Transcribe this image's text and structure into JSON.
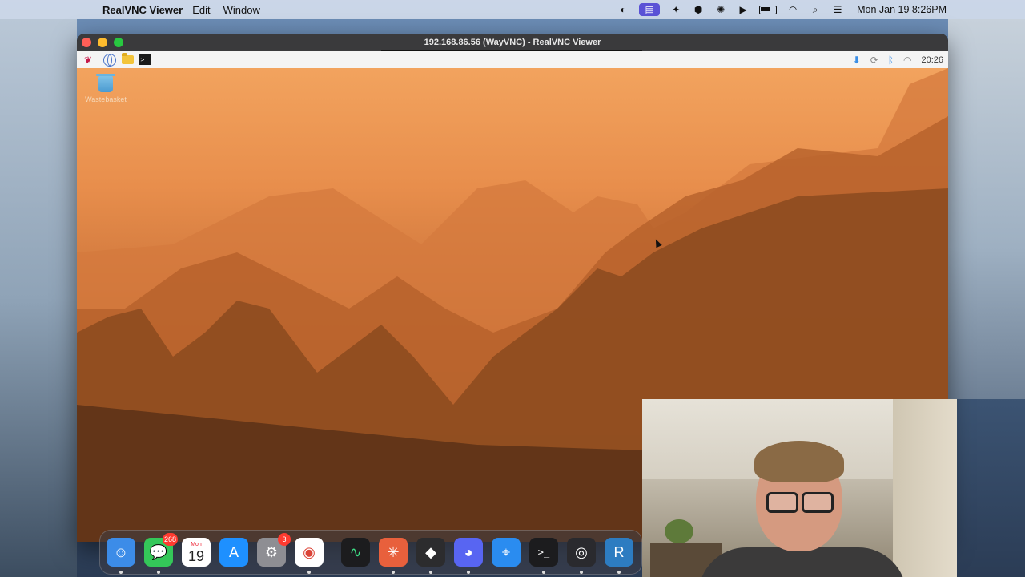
{
  "menubar": {
    "app_name": "RealVNC Viewer",
    "menus": [
      "Edit",
      "Window"
    ],
    "clock": "Mon Jan 19  8:26PM"
  },
  "vnc_window": {
    "title": "192.168.86.56 (WayVNC) - RealVNC Viewer"
  },
  "pi_taskbar": {
    "time": "20:26"
  },
  "pi_desktop": {
    "trash_label": "Wastebasket"
  },
  "dock": {
    "apps": [
      {
        "name": "Finder",
        "icon": "finder-icon",
        "color": "#3c8ce8"
      },
      {
        "name": "Messages",
        "icon": "messages-icon",
        "color": "#34c759",
        "badge": "268"
      },
      {
        "name": "Calendar",
        "icon": "calendar-icon",
        "month": "Mon",
        "day": "19"
      },
      {
        "name": "App Store",
        "icon": "app-store-icon",
        "color": "#1e90ff"
      },
      {
        "name": "System Settings",
        "icon": "settings-icon",
        "color": "#8e8e93",
        "badge": "3"
      },
      {
        "name": "Chrome",
        "icon": "chrome-icon",
        "color": "#ffffff"
      },
      {
        "name": "Activity Monitor",
        "icon": "activity-monitor-icon",
        "color": "#1c1c1e"
      },
      {
        "name": "Claude",
        "icon": "claude-icon",
        "color": "#e8603c"
      },
      {
        "name": "Unknown App",
        "icon": "cube-icon",
        "color": "#2c2c2e"
      },
      {
        "name": "Discord",
        "icon": "discord-icon",
        "color": "#5865f2"
      },
      {
        "name": "Safari",
        "icon": "safari-icon",
        "color": "#2a8cf0"
      },
      {
        "name": "Terminal",
        "icon": "terminal-icon",
        "color": "#1c1c1e"
      },
      {
        "name": "OBS",
        "icon": "obs-icon",
        "color": "#2a2a2e"
      },
      {
        "name": "RealVNC Viewer",
        "icon": "realvnc-icon",
        "color": "#2d7cc1"
      }
    ]
  }
}
